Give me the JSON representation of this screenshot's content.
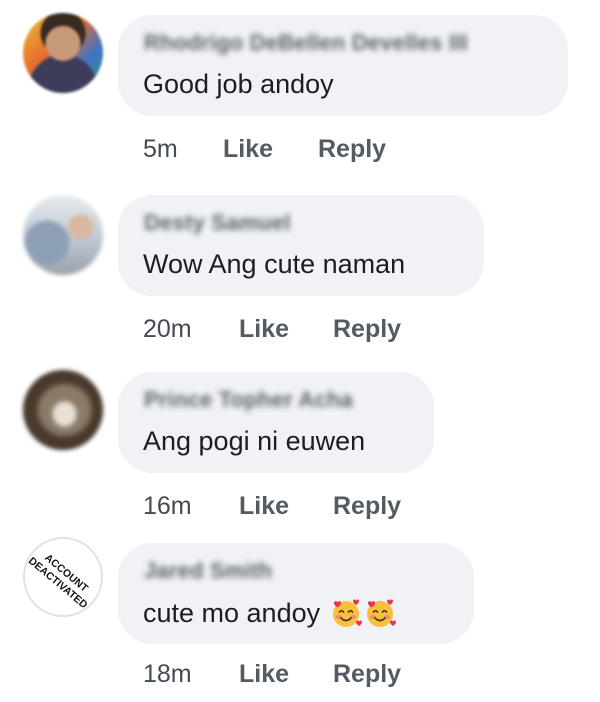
{
  "comments": [
    {
      "author": "Rhodrigo DeBellen Develles III",
      "text": "Good job andoy",
      "time": "5m",
      "like_label": "Like",
      "reply_label": "Reply",
      "avatar_icon": "profile-photo"
    },
    {
      "author": "Desty Samuel",
      "text": "Wow Ang cute naman",
      "time": "20m",
      "like_label": "Like",
      "reply_label": "Reply",
      "avatar_icon": "profile-photo"
    },
    {
      "author": "Prince Topher Acha",
      "text": "Ang pogi ni euwen",
      "time": "16m",
      "like_label": "Like",
      "reply_label": "Reply",
      "avatar_icon": "profile-photo"
    },
    {
      "author": "Jared Smith",
      "text": "cute mo andoy",
      "emoji": [
        "smiling-face-with-hearts",
        "smiling-face-with-hearts"
      ],
      "time": "18m",
      "like_label": "Like",
      "reply_label": "Reply",
      "avatar_icon": "account-deactivated-stamp",
      "avatar_stamp_text": "ACCOUNT DEACTIVATED"
    }
  ],
  "colors": {
    "bubble": "#f0f2f5",
    "text": "#1c1e21",
    "meta": "#555b63"
  }
}
